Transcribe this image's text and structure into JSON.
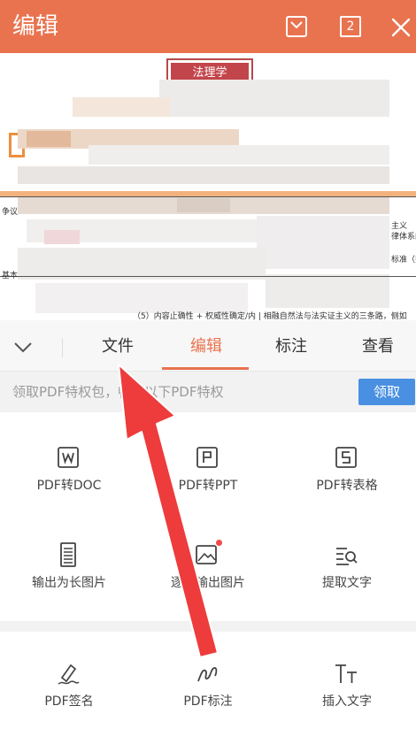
{
  "header": {
    "title": "编辑",
    "page_count": "2",
    "icons": [
      "save-icon",
      "pages-icon",
      "close-icon"
    ],
    "color": "#e9734f"
  },
  "document": {
    "title_box": "法理学",
    "snippets": {
      "left_small_1": "争议",
      "left_small_2": "基本",
      "right_1": "主义",
      "right_2": "律体系的",
      "right_3": "标准（拉",
      "bottom_line": "（5）内容止确性 + 权威性确定/内 | 相融自然法与法实证主义的三条路，侧如"
    }
  },
  "tabs": {
    "collapse_icon": "chevron-down-icon",
    "items": [
      "文件",
      "编辑",
      "标注",
      "查看"
    ],
    "active": "编辑",
    "accent": "#e9734f"
  },
  "promo": {
    "text": "领取PDF特权包，畅享以下PDF特权",
    "button": "领取",
    "button_color": "#4a90e2"
  },
  "tools": [
    {
      "label": "PDF转DOC",
      "icon": "word-doc-icon"
    },
    {
      "label": "PDF转PPT",
      "icon": "ppt-icon"
    },
    {
      "label": "PDF转表格",
      "icon": "spreadsheet-icon"
    },
    {
      "label": "输出为长图片",
      "icon": "long-image-icon"
    },
    {
      "label": "逐页输出图片",
      "icon": "image-export-icon"
    },
    {
      "label": "提取文字",
      "icon": "extract-text-icon"
    }
  ],
  "tools_row2": [
    {
      "label": "PDF签名",
      "icon": "signature-pen-icon"
    },
    {
      "label": "PDF标注",
      "icon": "annotation-icon"
    },
    {
      "label": "插入文字",
      "icon": "insert-text-icon"
    }
  ],
  "annotation": {
    "arrow_color": "#ee3b3b",
    "icon": "red-arrow-pointer-icon"
  }
}
